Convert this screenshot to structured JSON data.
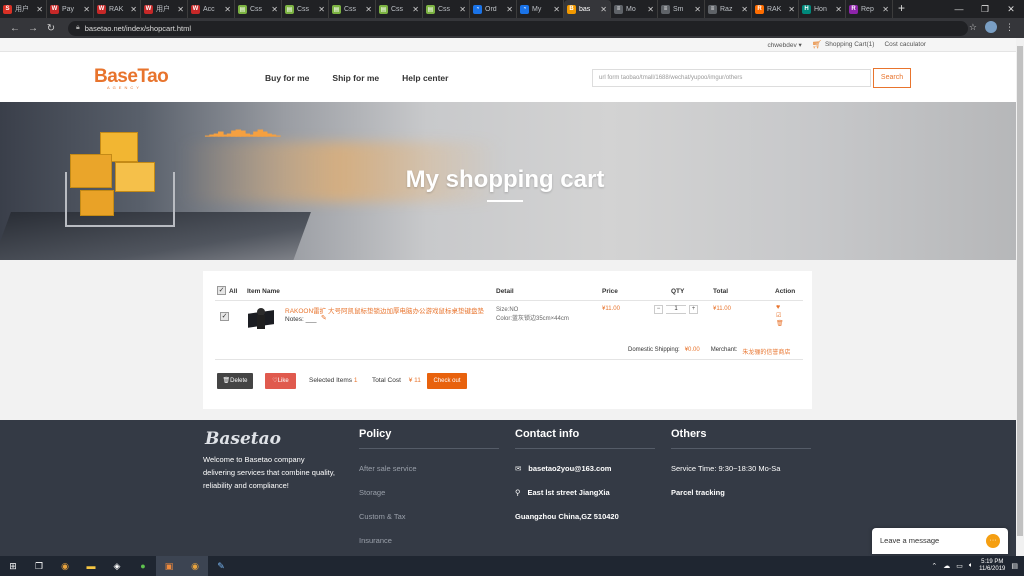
{
  "browser": {
    "tabs": [
      {
        "label": "用户",
        "color": "#d93025",
        "glyph": "S"
      },
      {
        "label": "Pay",
        "color": "#c62828",
        "glyph": "W"
      },
      {
        "label": "RAK",
        "color": "#c62828",
        "glyph": "W"
      },
      {
        "label": "用户",
        "color": "#c62828",
        "glyph": "W"
      },
      {
        "label": "Acc",
        "color": "#c62828",
        "glyph": "W"
      },
      {
        "label": "Css",
        "color": "#7cb342",
        "glyph": "▤"
      },
      {
        "label": "Css",
        "color": "#7cb342",
        "glyph": "▤"
      },
      {
        "label": "Css",
        "color": "#7cb342",
        "glyph": "▤"
      },
      {
        "label": "Css",
        "color": "#7cb342",
        "glyph": "▤"
      },
      {
        "label": "Css",
        "color": "#7cb342",
        "glyph": "▤"
      },
      {
        "label": "Ord",
        "color": "#1a73e8",
        "glyph": "◔"
      },
      {
        "label": "My",
        "color": "#1a73e8",
        "glyph": "◔"
      },
      {
        "label": "bas",
        "color": "#f29900",
        "glyph": "B"
      },
      {
        "label": "Mo",
        "color": "#5f6368",
        "glyph": "≡"
      },
      {
        "label": "Sm",
        "color": "#5f6368",
        "glyph": "≡"
      },
      {
        "label": "Raz",
        "color": "#5f6368",
        "glyph": "≡"
      },
      {
        "label": "RAK",
        "color": "#ff6d00",
        "glyph": "R"
      },
      {
        "label": "Hon",
        "color": "#00897b",
        "glyph": "H"
      },
      {
        "label": "Rep",
        "color": "#8e24aa",
        "glyph": "R"
      }
    ],
    "active_tab_index": 12,
    "new_tab": "+",
    "url": "basetao.net/index/shopcart.html"
  },
  "site_top": {
    "user": "chwebdev",
    "cart": "Shopping Cart(1)",
    "calc": "Cost caculator"
  },
  "header": {
    "logo": "BaseTao",
    "logo_sub": "AGENCY",
    "nav": [
      "Buy for me",
      "Ship for me",
      "Help center"
    ],
    "search_placeholder": "url form taobao/tmall/1688/wechat/yupoo/imgur/others",
    "search_button": "Search"
  },
  "banner": {
    "title": "My shopping cart"
  },
  "cart": {
    "columns": {
      "all": "All",
      "item_name": "Item Name",
      "detail": "Detail",
      "price": "Price",
      "qty": "QTY",
      "total": "Total",
      "action": "Action"
    },
    "item": {
      "name": "RAKOON雷扩 大号阿凯鼠标垫锁边加厚电脑办公游戏鼠标桌垫键盘垫",
      "notes": "Notes: ___",
      "size": "Size:NO",
      "color": "Color:蓝灰锁边35cm×44cm",
      "price": "¥11.00",
      "qty": "1",
      "total": "¥11.00"
    },
    "domestic_shipping_label": "Domestic Shipping:",
    "domestic_shipping_value": "¥0.00",
    "merchant_label": "Merchant:",
    "merchant_value": "朱龙骊的信誉商店",
    "delete": "Delete",
    "like": "Like",
    "selected_items_label": "Selected Items",
    "selected_items_value": "1",
    "total_cost_label": "Total Cost",
    "total_cost_value": "¥ 11",
    "checkout": "Check out"
  },
  "footer": {
    "logo": "Basetao",
    "desc": "Welcome to Basetao company delivering services that combine quality, reliability and compliance!",
    "policy": {
      "title": "Policy",
      "items": [
        "After sale service",
        "Storage",
        "Custom & Tax",
        "Insurance"
      ]
    },
    "contact": {
      "title": "Contact info",
      "email": "basetao2you@163.com",
      "address1": "East lst street JiangXia",
      "address2": "Guangzhou China,GZ 510420"
    },
    "others": {
      "title": "Others",
      "service_time": "Service Time: 9:30~18:30 Mo-Sa",
      "tracking": "Parcel tracking"
    }
  },
  "chat": {
    "label": "Leave a message"
  },
  "taskbar": {
    "time": "5:19 PM",
    "date": "11/6/2019"
  }
}
